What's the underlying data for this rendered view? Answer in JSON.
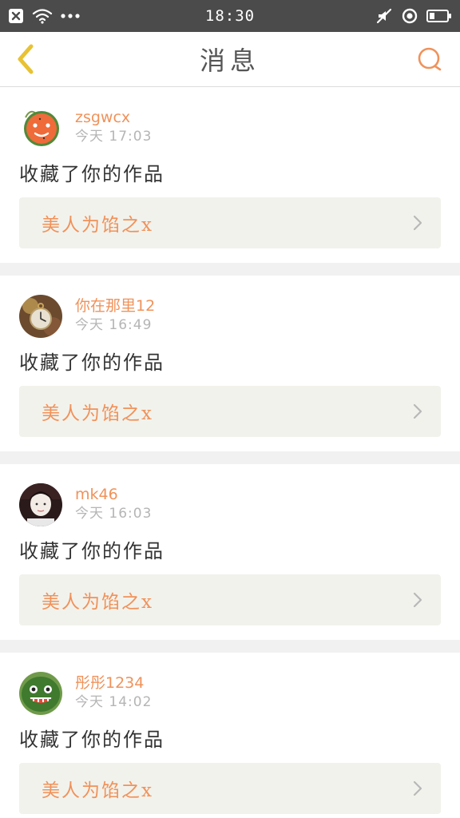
{
  "status_bar": {
    "time": "18:30"
  },
  "header": {
    "title": "消息",
    "back_icon": "chevron-left-icon",
    "search_icon": "search-icon"
  },
  "colors": {
    "accent": "#f0925a",
    "back_icon": "#e8c233",
    "status_bar_bg": "#4b4b4b",
    "link_bg": "#f2f2ec"
  },
  "notifications": [
    {
      "username": "zsgwcx",
      "time": "今天  17:03",
      "action": "收藏了你的作品",
      "work_title": "美人为馅之x",
      "avatar": "watermelon-slice"
    },
    {
      "username": "你在那里12",
      "time": "今天  16:49",
      "action": "收藏了你的作品",
      "work_title": "美人为馅之x",
      "avatar": "pocket-watch"
    },
    {
      "username": "mk46",
      "time": "今天  16:03",
      "action": "收藏了你的作品",
      "work_title": "美人为馅之x",
      "avatar": "portrait-photo"
    },
    {
      "username": "彤彤1234",
      "time": "今天  14:02",
      "action": "收藏了你的作品",
      "work_title": "美人为馅之x",
      "avatar": "watermelon-face"
    }
  ]
}
